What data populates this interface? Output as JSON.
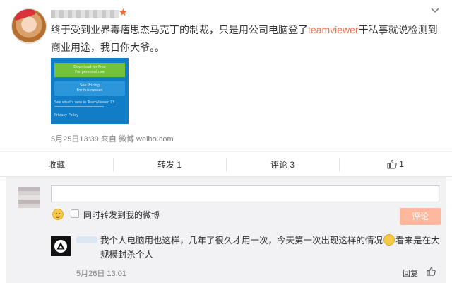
{
  "post": {
    "vip_star": "★",
    "text_before": "终于受到业界毒瘤思杰马克丁的制裁，只是用公司电脑登了",
    "keyword": "teamviewer",
    "text_after": "干私事就说检测到商业用途，我日你大爷。。",
    "image": {
      "download_label": "Download for Free",
      "download_sub": "For personal use",
      "pricing_label": "See Pricing",
      "pricing_sub": "For businesses",
      "whats_new": "See what's new in TeamViewer 13",
      "privacy": "Privacy Policy"
    },
    "meta": "5月25日13:39 来自 微博 weibo.com"
  },
  "actions": {
    "favorite": "收藏",
    "repost": "转发 1",
    "comment": "评论 3",
    "like_count": "1"
  },
  "comment_box": {
    "input_value": "",
    "also_repost_label": "同时转发到我的微博",
    "submit_label": "评论"
  },
  "reply": {
    "text_part1": "我个人电脑用也这样，几年了很久才用一次，今天第一次出现这样的情况",
    "text_part2": "看来是在大规模封杀个人",
    "time": "5月26日 13:01",
    "reply_label": "回复"
  },
  "colors": {
    "accent": "#eb7350",
    "submit_disabled": "#fdb89e",
    "comment_bg": "#f2f2f5"
  }
}
